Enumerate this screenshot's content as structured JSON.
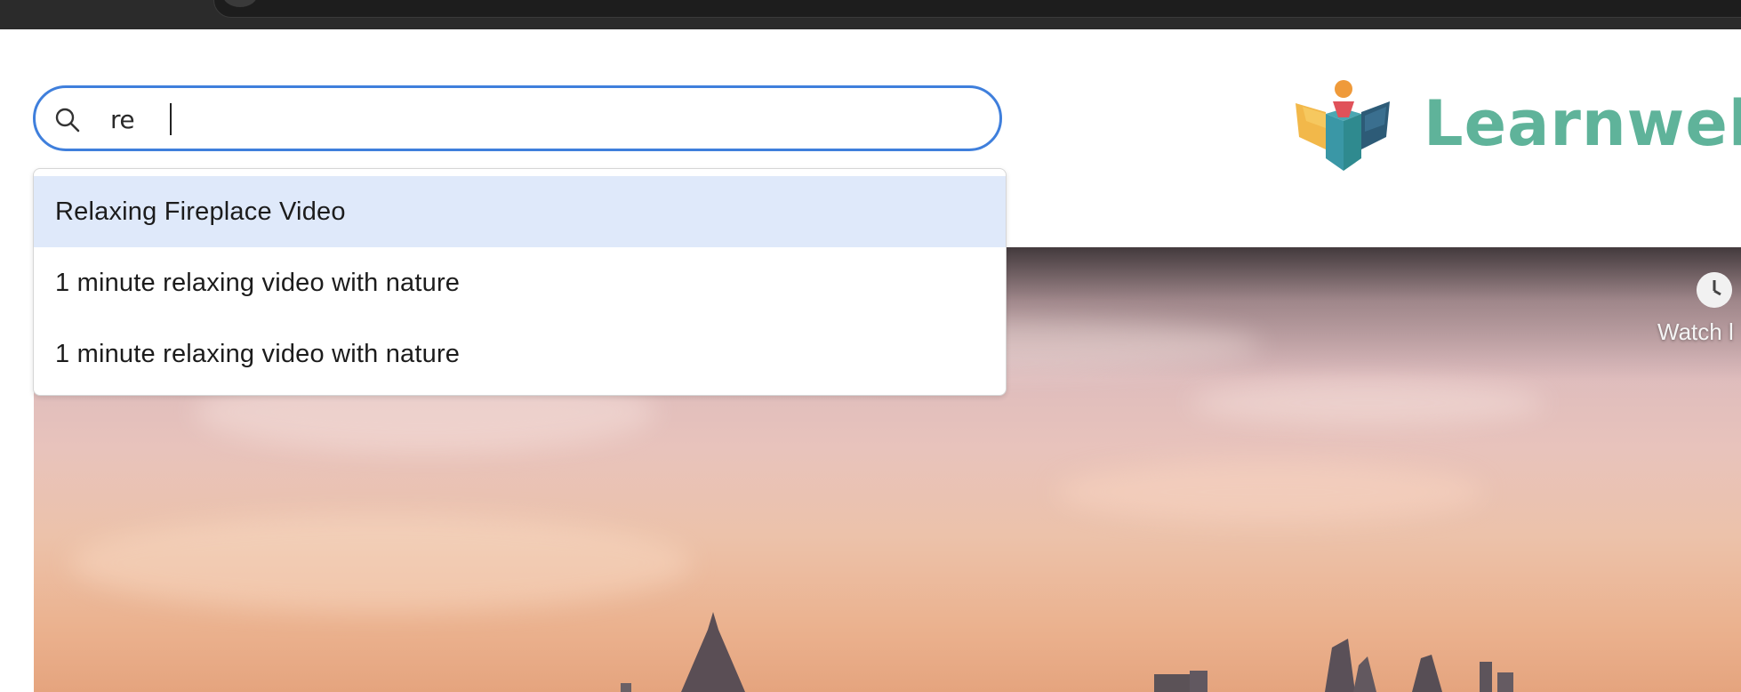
{
  "search": {
    "value": "re",
    "icon": "search-icon"
  },
  "suggestions": [
    {
      "label": "Relaxing Fireplace Video",
      "highlighted": true
    },
    {
      "label": "1 minute relaxing video with nature",
      "highlighted": false
    },
    {
      "label": "1 minute relaxing video with nature",
      "highlighted": false
    }
  ],
  "logo": {
    "text": "Learnwell",
    "color": "#5fb39a"
  },
  "hero": {
    "watch_label": "Watch l",
    "icon": "clock-icon"
  },
  "colors": {
    "accent": "#3f7fdc",
    "highlight": "#dfe9fa"
  }
}
